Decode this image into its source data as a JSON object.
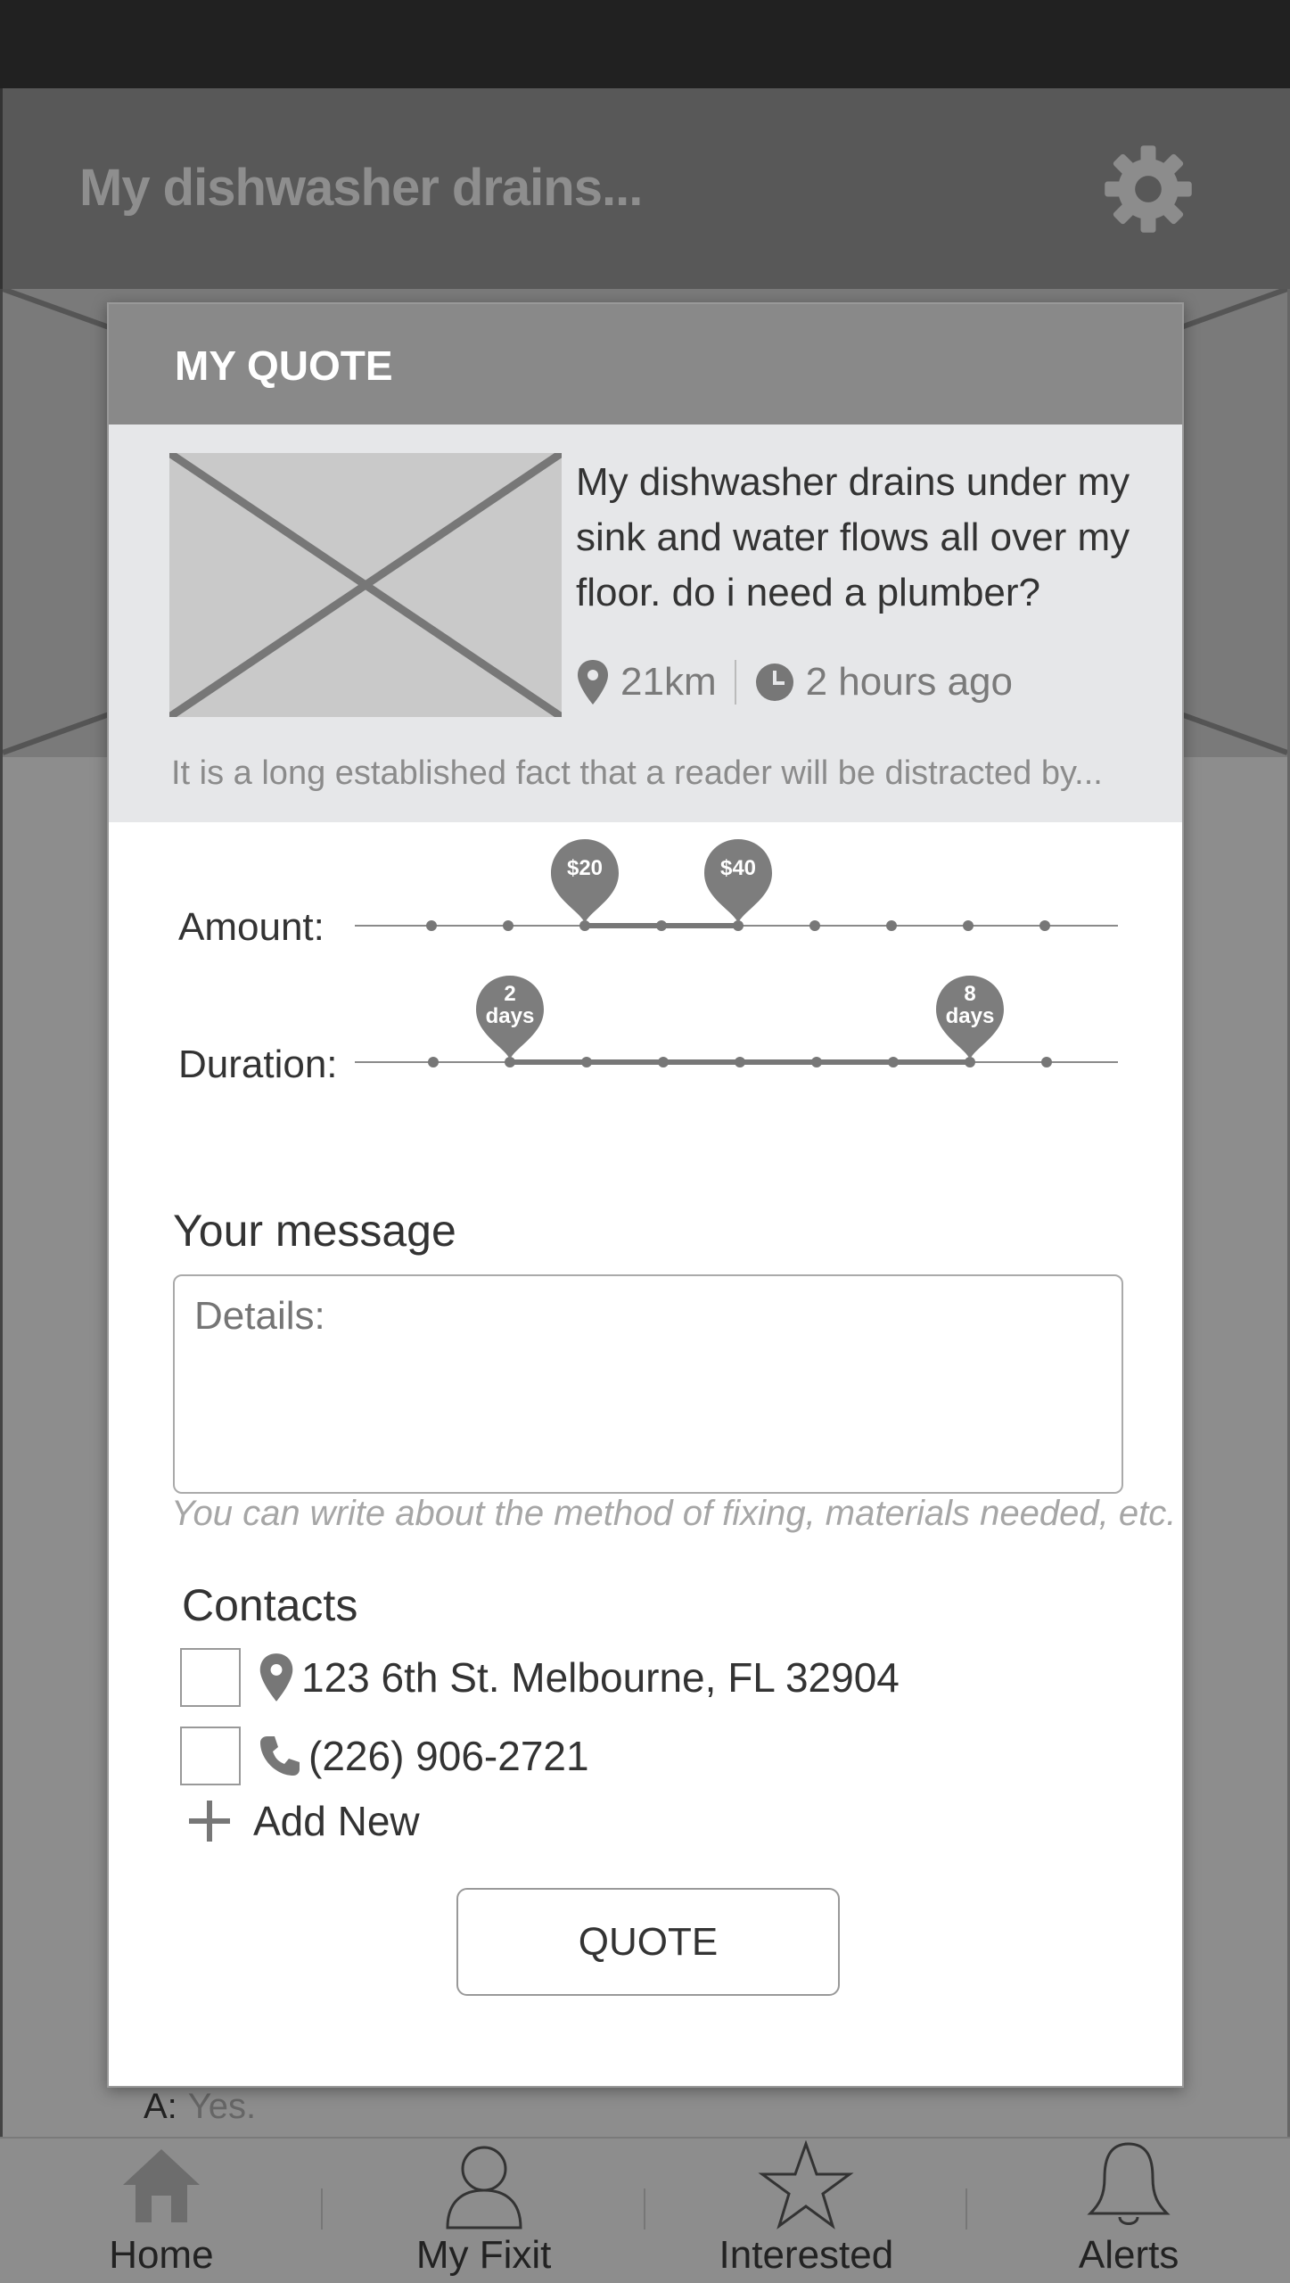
{
  "app_header": {
    "title": "My dishwasher drains..."
  },
  "background": {
    "answer_prefix": "A:",
    "answer_text": "Yes."
  },
  "modal": {
    "title": "MY QUOTE",
    "job": {
      "description": "My dishwasher drains under my sink and water flows all over my floor. do i need a plumber?",
      "distance": "21km",
      "time_ago": "2 hours ago",
      "summary": "It is a long established fact that a reader will be distracted by..."
    },
    "amount": {
      "label": "Amount:",
      "low_label": "$20",
      "high_label": "$40",
      "steps": 9,
      "low_index": 2,
      "high_index": 4
    },
    "duration": {
      "label": "Duration:",
      "low_label_line1": "2",
      "low_label_line2": "days",
      "high_label_line1": "8",
      "high_label_line2": "days",
      "steps": 9,
      "low_index": 1,
      "high_index": 7
    },
    "message": {
      "heading": "Your message",
      "placeholder": "Details:",
      "hint": "You can write about the method of fixing, materials needed, etc."
    },
    "contacts": {
      "heading": "Contacts",
      "address": "123 6th St. Melbourne, FL 32904",
      "phone": "(226) 906-2721",
      "add_new": "Add New"
    },
    "quote_button": "QUOTE"
  },
  "nav": {
    "items": [
      {
        "label": "Home",
        "icon": "home-icon"
      },
      {
        "label": "My Fixit",
        "icon": "user-icon"
      },
      {
        "label": "Interested",
        "icon": "star-icon"
      },
      {
        "label": "Alerts",
        "icon": "bell-icon"
      }
    ]
  },
  "colors": {
    "status_bar": "#212121",
    "header": "#585858",
    "modal_header": "#898989",
    "job_card": "#e6e7e9",
    "pin": "#7d7d7d"
  }
}
